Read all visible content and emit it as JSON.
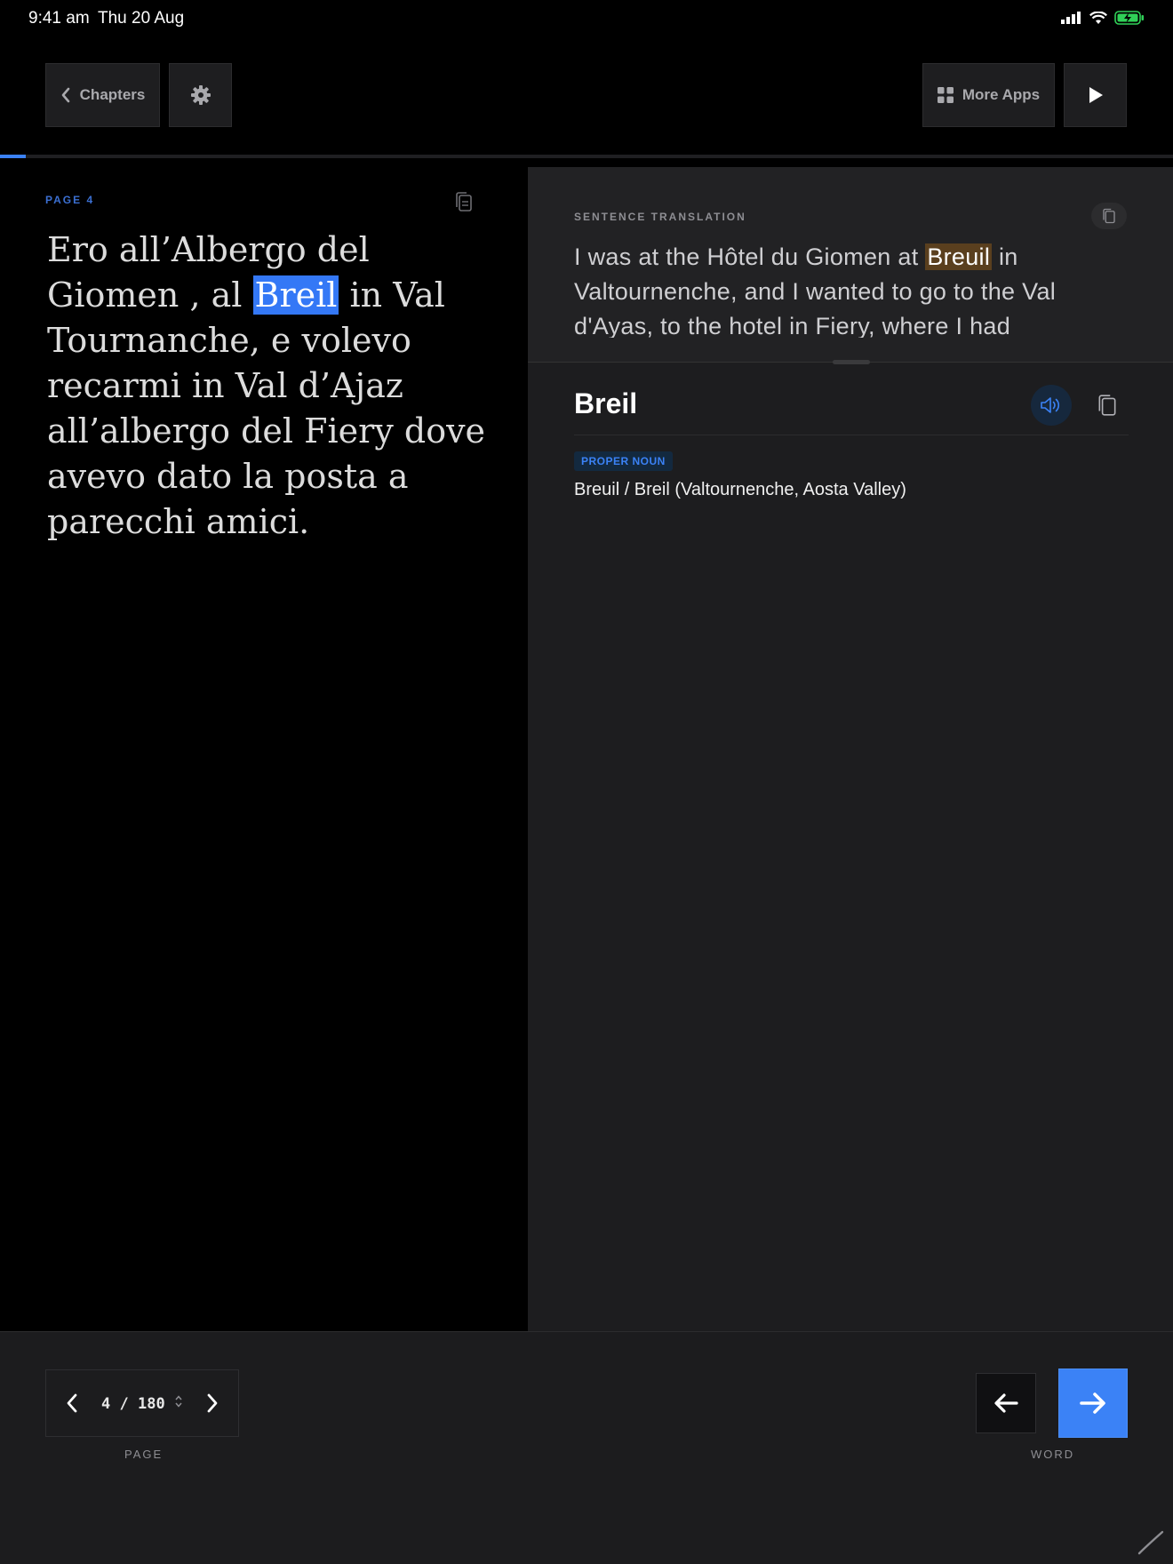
{
  "status_bar": {
    "time": "9:41 am",
    "date": "Thu 20 Aug",
    "battery_color": "#30d158"
  },
  "toolbar": {
    "chapters_label": "Chapters",
    "settings_icon": "gear-icon",
    "more_apps_label": "More Apps",
    "play_icon": "play-icon"
  },
  "reading_progress": 0.022,
  "source": {
    "page_label": "PAGE 4",
    "text_before": "Ero all’Albergo del Giomen , al ",
    "highlight": "Breil",
    "text_after": " in Val Tournanche, e volevo recarmi in Val d’Ajaz all’albergo del Fiery dove avevo dato la posta a parecchi amici."
  },
  "translation": {
    "label": "SENTENCE TRANSLATION",
    "text_before": "I was at the Hôtel du Giomen at ",
    "highlight": "Breuil",
    "text_after": " in Valtournenche, and I wanted to go to the Val d'Ayas, to the hotel in Fiery, where I had"
  },
  "word": {
    "headword": "Breil",
    "part_of_speech": "PROPER NOUN",
    "definition": "Breuil / Breil (Valtournenche, Aosta Valley)"
  },
  "pager": {
    "current": "4",
    "separator": "/",
    "total": "180",
    "label": "PAGE"
  },
  "word_nav": {
    "label": "WORD"
  },
  "colors": {
    "accent": "#3b82f6",
    "source_highlight": "#3478f6",
    "translation_highlight": "#5a3f1e"
  }
}
